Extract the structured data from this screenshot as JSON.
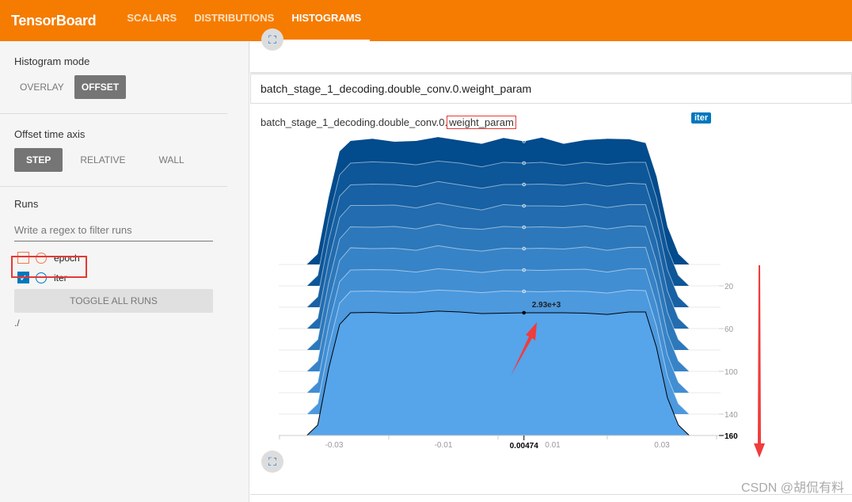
{
  "header": {
    "brand": "TensorBoard",
    "tabs": [
      {
        "label": "SCALARS"
      },
      {
        "label": "DISTRIBUTIONS"
      },
      {
        "label": "HISTOGRAMS",
        "active": true
      }
    ],
    "color": "#f57c00"
  },
  "sidebar": {
    "histogram_mode": {
      "title": "Histogram mode",
      "options": [
        "OVERLAY",
        "OFFSET"
      ],
      "selected": "OFFSET"
    },
    "offset_axis": {
      "title": "Offset time axis",
      "options": [
        "STEP",
        "RELATIVE",
        "WALL"
      ],
      "selected": "STEP"
    },
    "runs": {
      "title": "Runs",
      "filter_placeholder": "Write a regex to filter runs",
      "items": [
        {
          "name": "epoch",
          "checked": false,
          "color": "#f4774a"
        },
        {
          "name": "iter",
          "checked": true,
          "color": "#0277bd"
        }
      ],
      "toggle_label": "TOGGLE ALL RUNS",
      "path": "./"
    }
  },
  "main": {
    "category": "batch_stage_1_decoding.double_conv.0.weight_param",
    "card_title_prefix": "batch_stage_1_decoding.double_conv.0.",
    "card_title_highlight": "weight_param",
    "run_tag": "iter",
    "fullscreen_icon": "fullscreen-icon"
  },
  "chart_data": {
    "type": "histogram-offset",
    "x_ticks": [
      "-0.03",
      "-0.01",
      "0.01",
      "0.03"
    ],
    "x_tick_values": [
      -0.03,
      -0.01,
      0.01,
      0.03
    ],
    "y_ticks": [
      "20",
      "60",
      "100",
      "140",
      "160"
    ],
    "y_tick_values": [
      20,
      60,
      100,
      140,
      160
    ],
    "ylim": [
      0,
      160
    ],
    "xlim": [
      -0.04,
      0.041
    ],
    "hover_x_label": "0.00474",
    "hover_value_label": "2.93e+3",
    "colors": {
      "top": "#024b8c",
      "bottom": "#56a4ea"
    },
    "x": [
      -0.035,
      -0.033,
      -0.031,
      -0.029,
      -0.027,
      -0.023,
      -0.019,
      -0.015,
      -0.011,
      -0.007,
      -0.003,
      0.001,
      0.00474,
      0.008,
      0.012,
      0.016,
      0.02,
      0.024,
      0.027,
      0.029,
      0.031,
      0.033,
      0.035
    ],
    "series": [
      {
        "step": 0,
        "values": [
          0,
          250,
          1600,
          2700,
          2950,
          3000,
          2930,
          2950,
          3040,
          2960,
          2880,
          3020,
          2940,
          3030,
          2880,
          2970,
          3000,
          2990,
          2900,
          2100,
          900,
          250,
          0
        ]
      },
      {
        "step": 20,
        "values": [
          0,
          250,
          1600,
          2650,
          2930,
          2960,
          2940,
          2890,
          2980,
          2930,
          2840,
          2950,
          2930,
          2950,
          2880,
          2950,
          2900,
          2950,
          2950,
          2100,
          900,
          250,
          0
        ]
      },
      {
        "step": 40,
        "values": [
          0,
          250,
          1600,
          2650,
          2920,
          2940,
          2930,
          2880,
          3000,
          2920,
          2840,
          2930,
          2930,
          2940,
          2910,
          2970,
          2890,
          2960,
          2940,
          2100,
          900,
          250,
          0
        ]
      },
      {
        "step": 60,
        "values": [
          0,
          250,
          1600,
          2650,
          2940,
          2940,
          2950,
          2880,
          3000,
          2910,
          2830,
          2960,
          2930,
          2930,
          2920,
          2970,
          2890,
          2960,
          2960,
          2100,
          900,
          250,
          0
        ]
      },
      {
        "step": 80,
        "values": [
          0,
          250,
          1600,
          2650,
          2940,
          2930,
          2950,
          2890,
          3000,
          2910,
          2880,
          2950,
          2930,
          2940,
          2920,
          2960,
          2890,
          2960,
          2950,
          2100,
          900,
          250,
          0
        ]
      },
      {
        "step": 100,
        "values": [
          0,
          250,
          1600,
          2650,
          2950,
          2930,
          2940,
          2890,
          3000,
          2920,
          2870,
          2940,
          2930,
          2940,
          2920,
          2970,
          2890,
          2960,
          2960,
          2100,
          900,
          250,
          0
        ]
      },
      {
        "step": 120,
        "values": [
          0,
          250,
          1600,
          2650,
          2930,
          2940,
          2930,
          2880,
          2960,
          2920,
          2870,
          2930,
          2930,
          2920,
          2940,
          2950,
          2880,
          2960,
          2960,
          2100,
          900,
          250,
          0
        ]
      },
      {
        "step": 140,
        "values": [
          0,
          250,
          1600,
          2650,
          2930,
          2940,
          2920,
          2910,
          2960,
          2940,
          2900,
          2940,
          2930,
          2920,
          2940,
          2930,
          2890,
          2960,
          2950,
          2100,
          900,
          250,
          0
        ]
      },
      {
        "step": 160,
        "values": [
          0,
          250,
          1600,
          2650,
          2930,
          2940,
          2920,
          2930,
          2970,
          2950,
          2910,
          2920,
          2930,
          2930,
          2930,
          2920,
          2890,
          2950,
          2950,
          2100,
          900,
          250,
          0
        ]
      }
    ]
  },
  "watermark": "CSDN @胡侃有料"
}
